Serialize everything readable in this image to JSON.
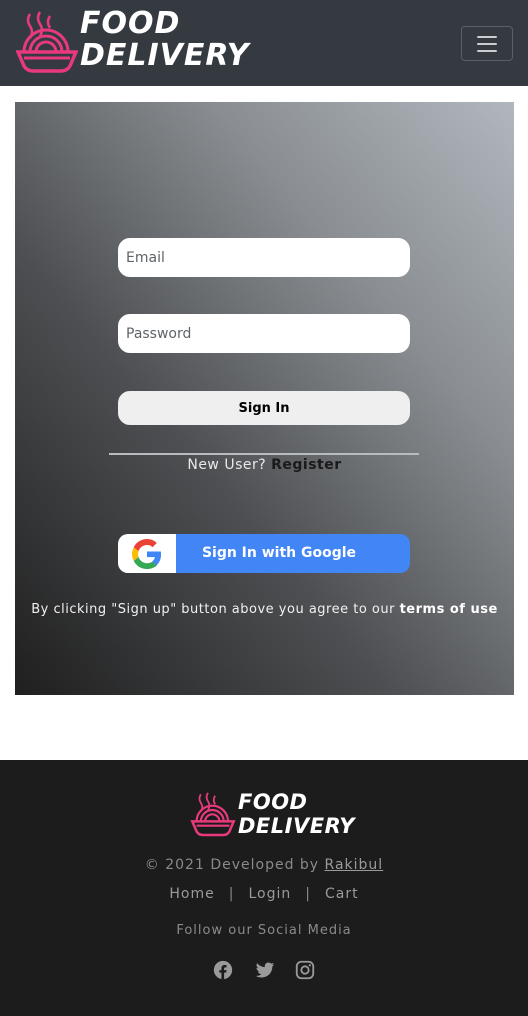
{
  "navbar": {
    "brand_line1": "FOOD",
    "brand_line2": "DELIVERY",
    "menu_icon": "hamburger-icon"
  },
  "login": {
    "email_placeholder": "Email",
    "password_placeholder": "Password",
    "signin_label": "Sign In",
    "new_user_text": "New User?",
    "register_link": "Register",
    "google_label": "Sign In with Google",
    "terms_text": "By clicking \"Sign up\" button above you agree to our",
    "terms_link": "terms of use"
  },
  "footer": {
    "brand_line1": "FOOD",
    "brand_line2": "DELIVERY",
    "copyright": "© 2021 Developed by",
    "author": "Rakibul",
    "nav": [
      "Home",
      "Login",
      "Cart"
    ],
    "follow": "Follow our Social Media",
    "social_icons": [
      "facebook-icon",
      "twitter-icon",
      "instagram-icon"
    ]
  },
  "colors": {
    "navbar_bg": "#343a40",
    "footer_bg": "#1c1c1c",
    "brand_accent": "#e8397d",
    "google_blue": "#4285f4"
  }
}
